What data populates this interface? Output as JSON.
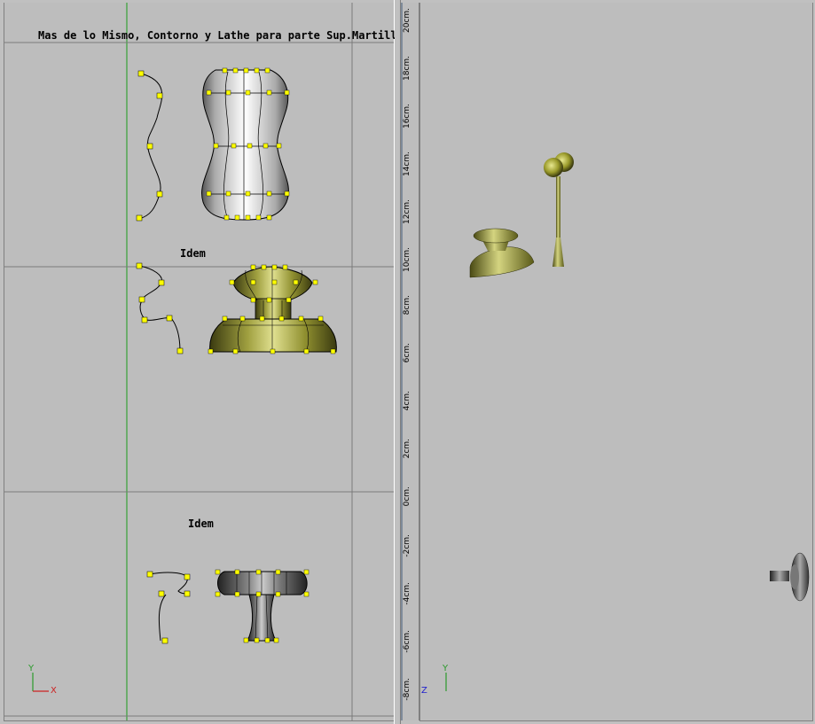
{
  "scene_title": "Mas de lo Mismo, Contorno y Lathe para parte Sup.Martillo",
  "labels": {
    "idem_1": "Idem",
    "idem_2": "Idem"
  },
  "ruler_ticks": [
    "20cm.",
    "18cm.",
    "16cm.",
    "14cm.",
    "12cm.",
    "10cm.",
    "8cm.",
    "6cm.",
    "4cm.",
    "2cm.",
    "0cm.",
    "-2cm.",
    "-4cm.",
    "-6cm.",
    "-8cm."
  ],
  "axes": {
    "left": {
      "vertical": "Y",
      "horizontal": "X"
    },
    "right": {
      "depth": "Z",
      "vertical": "Y"
    }
  },
  "colors": {
    "viewport_bg": "#bdbdbd",
    "guide_green": "#1a9a1a",
    "guide_gray": "#7a7a7a",
    "control_point": "#ffff00",
    "olive_object": "#9a9a2a",
    "dark_object": "#5a5a5a"
  },
  "icons": {
    "axis_gizmo": "axis-icon"
  }
}
